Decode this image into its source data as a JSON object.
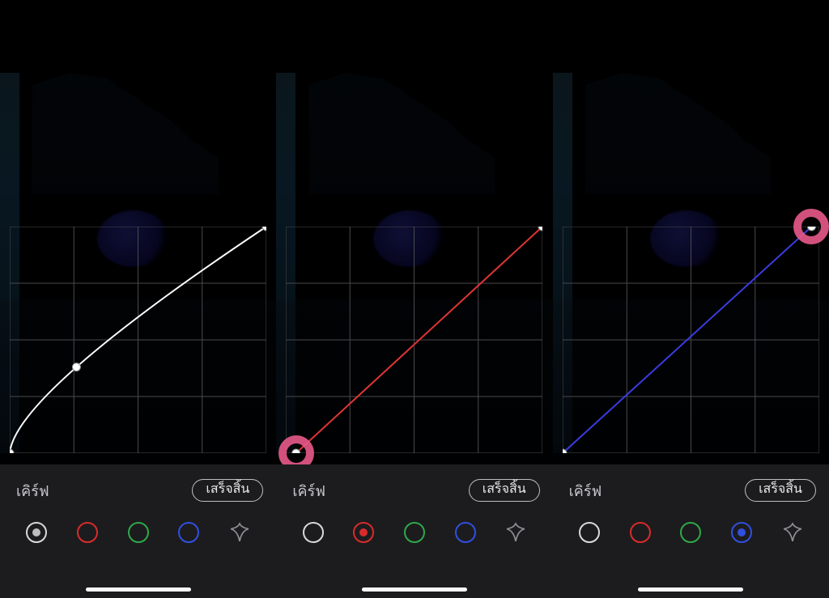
{
  "panels": [
    {
      "toolLabel": "เคิร์ฟ",
      "resetLabel": "เสร็จสิ้น",
      "channels": [
        {
          "name": "luma",
          "color": "white",
          "selected": true
        },
        {
          "name": "red",
          "color": "red",
          "selected": false
        },
        {
          "name": "green",
          "color": "green",
          "selected": false
        },
        {
          "name": "blue",
          "color": "blue",
          "selected": false
        }
      ],
      "curve": {
        "color": "#ffffff",
        "points": [
          {
            "x": 0.0,
            "y": 0.0
          },
          {
            "x": 0.26,
            "y": 0.38
          },
          {
            "x": 1.0,
            "y": 1.0
          }
        ],
        "highlight": null
      }
    },
    {
      "toolLabel": "เคิร์ฟ",
      "resetLabel": "เสร็จสิ้น",
      "channels": [
        {
          "name": "luma",
          "color": "white",
          "selected": false
        },
        {
          "name": "red",
          "color": "red",
          "selected": true
        },
        {
          "name": "green",
          "color": "green",
          "selected": false
        },
        {
          "name": "blue",
          "color": "blue",
          "selected": false
        }
      ],
      "curve": {
        "color": "#e03535",
        "points": [
          {
            "x": 0.04,
            "y": 0.0
          },
          {
            "x": 1.0,
            "y": 1.0
          }
        ],
        "highlight": {
          "idx": 0
        }
      }
    },
    {
      "toolLabel": "เคิร์ฟ",
      "resetLabel": "เสร็จสิ้น",
      "channels": [
        {
          "name": "luma",
          "color": "white",
          "selected": false
        },
        {
          "name": "red",
          "color": "red",
          "selected": false
        },
        {
          "name": "green",
          "color": "green",
          "selected": false
        },
        {
          "name": "blue",
          "color": "blue",
          "selected": true
        }
      ],
      "curve": {
        "color": "#3a3ce0",
        "points": [
          {
            "x": 0.0,
            "y": 0.0
          },
          {
            "x": 0.97,
            "y": 1.0
          }
        ],
        "highlight": {
          "idx": 1
        }
      }
    }
  ]
}
